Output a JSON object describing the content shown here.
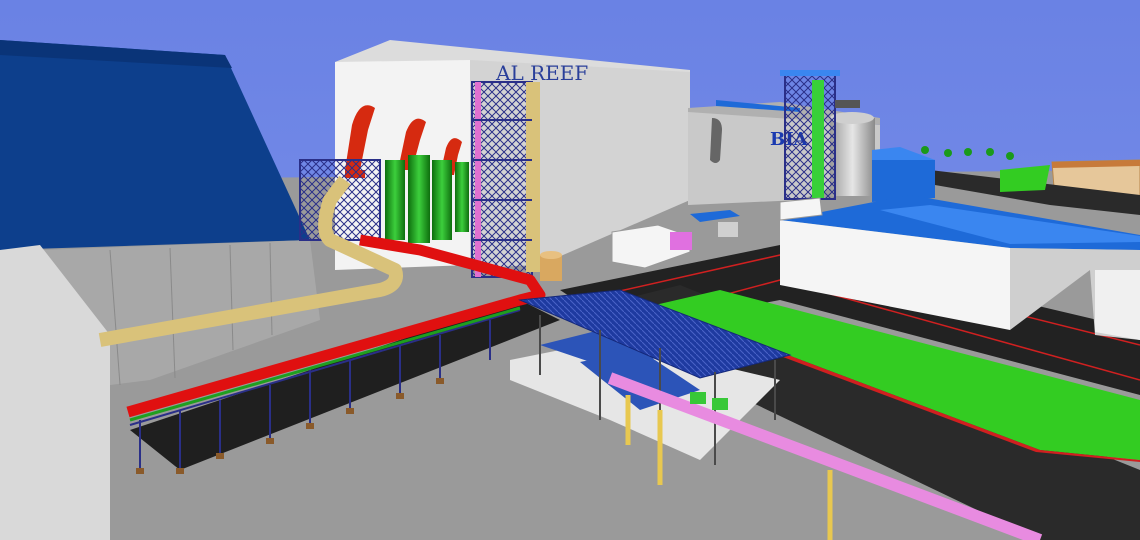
{
  "scene": {
    "building_sign_main": "AL REEF",
    "building_sign_secondary": "BIA",
    "colors": {
      "sky": "#6f86e6",
      "roof_blue": "#0d3f8c",
      "building_white": "#f3f3f3",
      "building_grey": "#bdbdbd",
      "ground": "#9a9a9a",
      "road": "#222222",
      "grass": "#33cc22",
      "pipe_red": "#e01010",
      "pipe_tan": "#d9c27a",
      "pipe_pink": "#e88be0",
      "steel_blue": "#2a2f88",
      "canopy_blue": "#1e3aa0",
      "green_vessel": "#1f9f1f",
      "red_stack": "#d62a10"
    }
  }
}
